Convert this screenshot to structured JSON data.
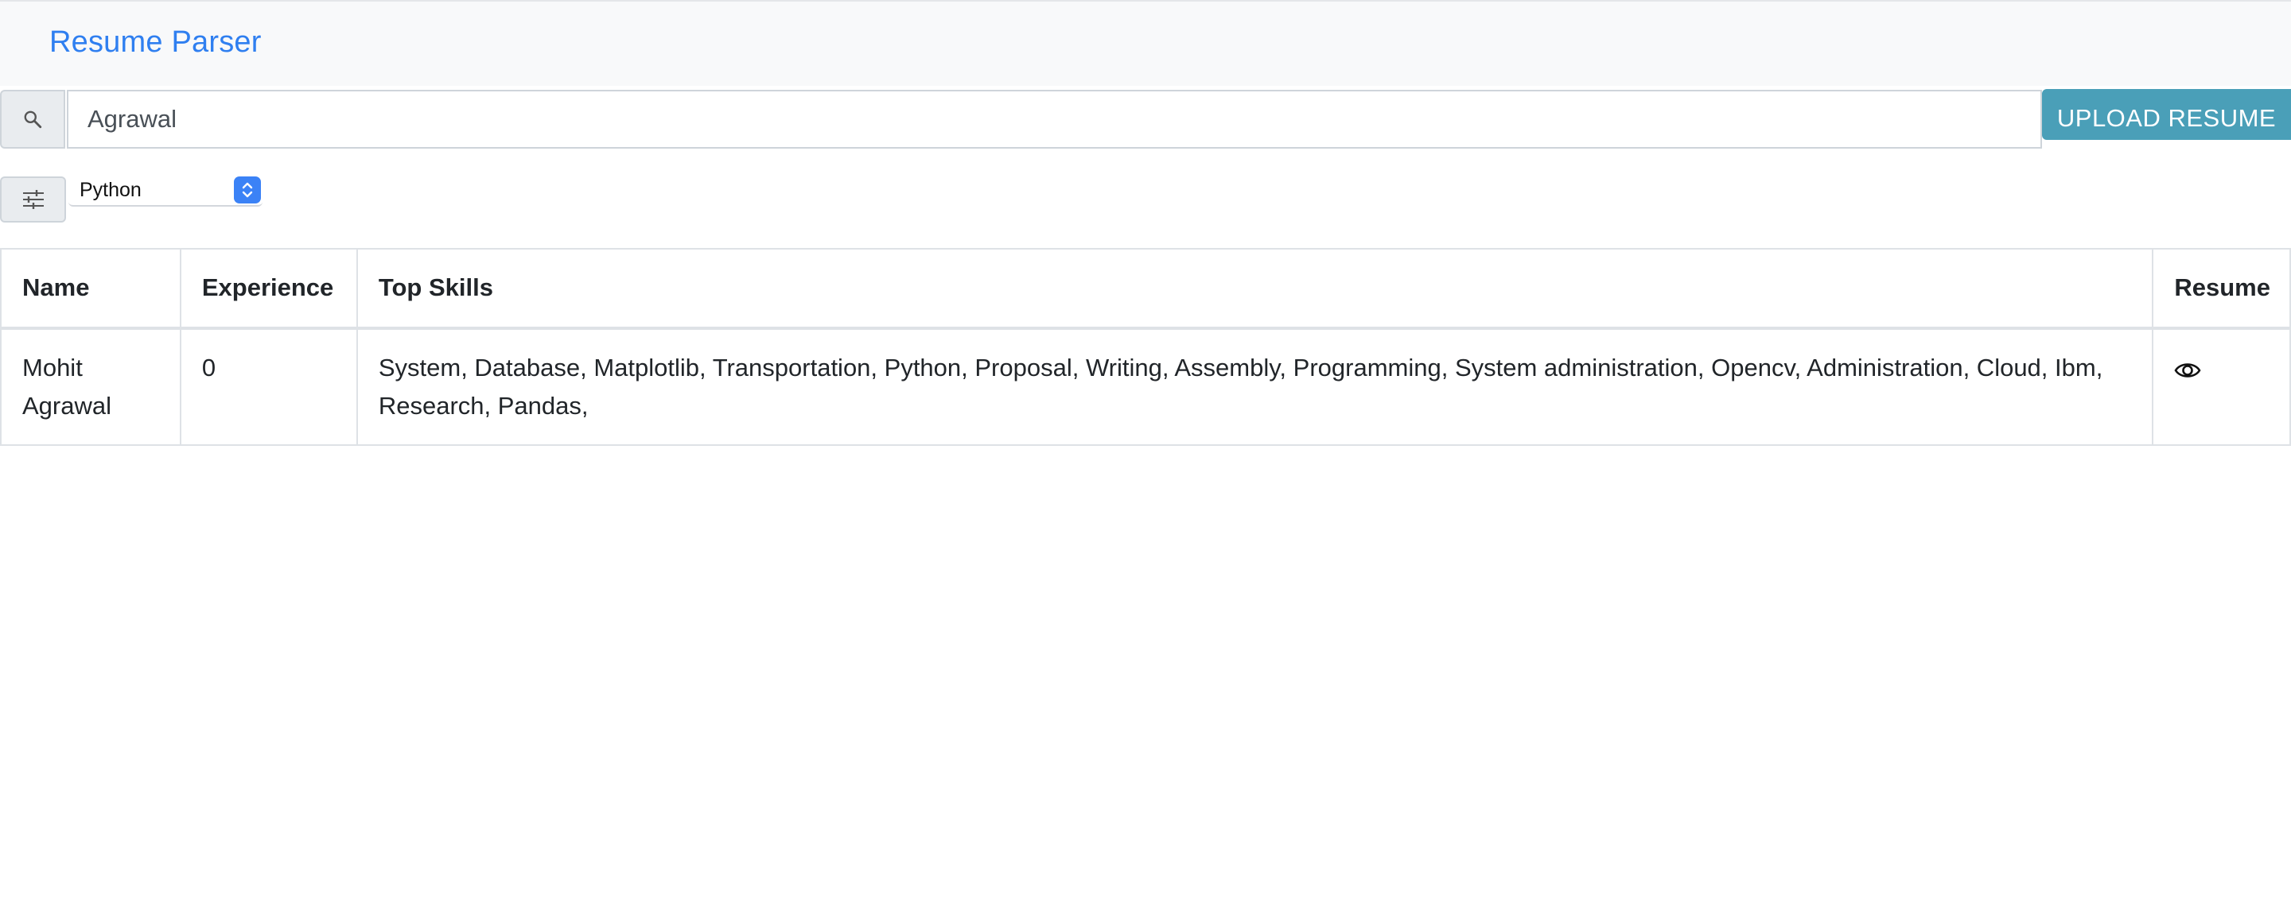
{
  "app": {
    "brand": "Resume Parser"
  },
  "search": {
    "value": "Agrawal",
    "icon": "search-icon"
  },
  "toolbar": {
    "upload_label": "UPLOAD RESUME",
    "filter_icon": "sliders-icon"
  },
  "filter": {
    "selected_skill": "Python"
  },
  "table": {
    "headers": {
      "name": "Name",
      "experience": "Experience",
      "skills": "Top Skills",
      "resume": "Resume"
    },
    "rows": [
      {
        "name": "Mohit Agrawal",
        "experience": "0",
        "skills": "System, Database, Matplotlib, Transportation, Python, Proposal, Writing, Assembly, Programming, System administration, Opencv, Administration, Cloud, Ibm, Research, Pandas,",
        "resume_icon": "eye-icon"
      }
    ]
  },
  "colors": {
    "brand": "#2f7ff0",
    "upload_button": "#4a9fb8",
    "select_accent": "#3b82f6"
  }
}
